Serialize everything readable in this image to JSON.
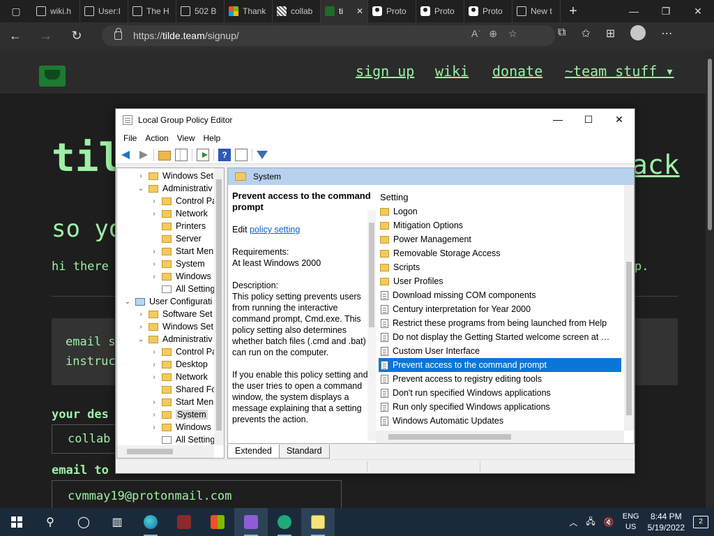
{
  "browser": {
    "tabs": [
      {
        "label": "wiki.h",
        "icon": "page-icon",
        "active": false
      },
      {
        "label": "User:I",
        "icon": "page-icon",
        "active": false
      },
      {
        "label": "The H",
        "icon": "page-icon",
        "active": false
      },
      {
        "label": "502 B",
        "icon": "page-icon",
        "active": false
      },
      {
        "label": "Thank",
        "icon": "microsoft-icon",
        "active": false
      },
      {
        "label": "collab",
        "icon": "grid-icon",
        "active": false
      },
      {
        "label": "ti",
        "icon": "tilde-icon",
        "active": true
      },
      {
        "label": "Proto",
        "icon": "person-icon",
        "active": false
      },
      {
        "label": "Proto",
        "icon": "person-icon",
        "active": false
      },
      {
        "label": "Proto",
        "icon": "person-icon",
        "active": false
      },
      {
        "label": "New t",
        "icon": "newtab-icon",
        "active": false
      }
    ],
    "url_scheme": "https://",
    "url_host": "tilde.team",
    "url_path": "/signup/"
  },
  "site": {
    "nav": [
      "sign up",
      "wiki",
      "donate",
      "~team stuff ▾"
    ],
    "title_fragment": "til",
    "title_right_fragment": "ack",
    "subtitle_fragment": "so yo",
    "hi_fragment": "hi there",
    "hi_tail": "p.",
    "email_box_line1": "email s",
    "email_box_line2": "instruc",
    "label_desire": "your des",
    "username_value": "collab",
    "label_email": "email to",
    "email_value": "cvmmay19@protonmail.com"
  },
  "gpedit": {
    "title": "Local Group Policy Editor",
    "menu": [
      "File",
      "Action",
      "View",
      "Help"
    ],
    "tree": [
      {
        "label": "Windows Set",
        "indent": 1,
        "arrow": ">",
        "icon": "folder"
      },
      {
        "label": "Administrativ",
        "indent": 1,
        "arrow": "v",
        "icon": "folder"
      },
      {
        "label": "Control Pa",
        "indent": 2,
        "arrow": ">",
        "icon": "folder"
      },
      {
        "label": "Network",
        "indent": 2,
        "arrow": ">",
        "icon": "folder"
      },
      {
        "label": "Printers",
        "indent": 2,
        "arrow": "",
        "icon": "folder"
      },
      {
        "label": "Server",
        "indent": 2,
        "arrow": "",
        "icon": "folder"
      },
      {
        "label": "Start Men",
        "indent": 2,
        "arrow": ">",
        "icon": "folder"
      },
      {
        "label": "System",
        "indent": 2,
        "arrow": ">",
        "icon": "folder"
      },
      {
        "label": "Windows",
        "indent": 2,
        "arrow": ">",
        "icon": "folder"
      },
      {
        "label": "All Setting",
        "indent": 2,
        "arrow": "",
        "icon": "doc"
      },
      {
        "label": "User Configurati",
        "indent": 0,
        "arrow": "v",
        "icon": "computer"
      },
      {
        "label": "Software Set",
        "indent": 1,
        "arrow": ">",
        "icon": "folder"
      },
      {
        "label": "Windows Set",
        "indent": 1,
        "arrow": ">",
        "icon": "folder"
      },
      {
        "label": "Administrativ",
        "indent": 1,
        "arrow": "v",
        "icon": "folder"
      },
      {
        "label": "Control Pa",
        "indent": 2,
        "arrow": ">",
        "icon": "folder"
      },
      {
        "label": "Desktop",
        "indent": 2,
        "arrow": ">",
        "icon": "folder"
      },
      {
        "label": "Network",
        "indent": 2,
        "arrow": ">",
        "icon": "folder"
      },
      {
        "label": "Shared Fo",
        "indent": 2,
        "arrow": "",
        "icon": "folder"
      },
      {
        "label": "Start Men",
        "indent": 2,
        "arrow": ">",
        "icon": "folder"
      },
      {
        "label": "System",
        "indent": 2,
        "arrow": ">",
        "icon": "folder",
        "selected": true
      },
      {
        "label": "Windows",
        "indent": 2,
        "arrow": ">",
        "icon": "folder"
      },
      {
        "label": "All Setting",
        "indent": 2,
        "arrow": "",
        "icon": "doc"
      }
    ],
    "right_header": "System",
    "desc": {
      "title": "Prevent access to the command prompt",
      "edit_prefix": "Edit ",
      "edit_link": "policy setting",
      "req_label": "Requirements:",
      "req_value": "At least Windows 2000",
      "desc_label": "Description:",
      "desc_text": "This policy setting prevents users from running the interactive command prompt, Cmd.exe.  This policy setting also determines whether batch files (.cmd and .bat) can run on the computer.",
      "desc_text2": "If you enable this policy setting and the user tries to open a command window, the system displays a message explaining that a setting prevents the action."
    },
    "list_header": "Setting",
    "list": [
      {
        "label": "Logon",
        "icon": "folder"
      },
      {
        "label": "Mitigation Options",
        "icon": "folder"
      },
      {
        "label": "Power Management",
        "icon": "folder"
      },
      {
        "label": "Removable Storage Access",
        "icon": "folder"
      },
      {
        "label": "Scripts",
        "icon": "folder"
      },
      {
        "label": "User Profiles",
        "icon": "folder"
      },
      {
        "label": "Download missing COM components",
        "icon": "policy"
      },
      {
        "label": "Century interpretation for Year 2000",
        "icon": "policy"
      },
      {
        "label": "Restrict these programs from being launched from Help",
        "icon": "policy"
      },
      {
        "label": "Do not display the Getting Started welcome screen at …",
        "icon": "policy"
      },
      {
        "label": "Custom User Interface",
        "icon": "policy"
      },
      {
        "label": "Prevent access to the command prompt",
        "icon": "policy",
        "selected": true
      },
      {
        "label": "Prevent access to registry editing tools",
        "icon": "policy"
      },
      {
        "label": "Don't run specified Windows applications",
        "icon": "policy"
      },
      {
        "label": "Run only specified Windows applications",
        "icon": "policy"
      },
      {
        "label": "Windows Automatic Updates",
        "icon": "policy"
      }
    ],
    "view_tabs": [
      "Extended",
      "Standard"
    ]
  },
  "taskbar": {
    "lang_top": "ENG",
    "lang_bottom": "US",
    "time": "8:44 PM",
    "date": "5/19/2022",
    "notifications": "2"
  }
}
